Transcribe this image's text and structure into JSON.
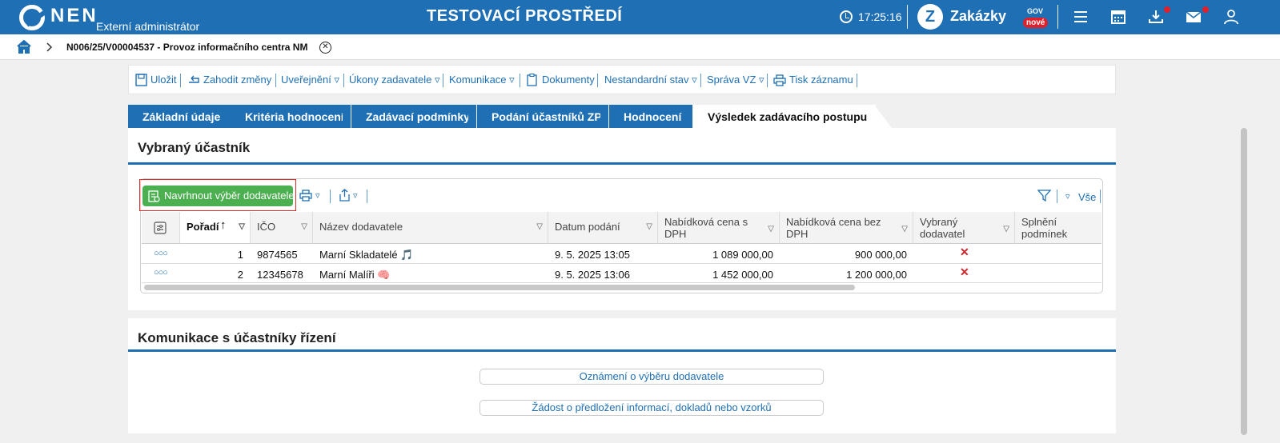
{
  "header": {
    "logo": "NEN",
    "user_role": "Externí administrátor",
    "environment": "TESTOVACÍ PROSTŘEDÍ",
    "time": "17:25:16",
    "product": "Zakázky",
    "product_sup": "GOV",
    "product_badge": "nové",
    "icons": [
      "menu-icon",
      "calendar-icon",
      "download-icon",
      "mail-icon",
      "user-icon"
    ]
  },
  "breadcrumb": {
    "record": "N006/25/V00004537 - Provoz informačního centra NM"
  },
  "toolbar": {
    "save": "Uložit",
    "discard": "Zahodit změny",
    "publish": "Uveřejnění",
    "actions": "Úkony zadavatele",
    "communication": "Komunikace",
    "documents": "Dokumenty",
    "nonstandard": "Nestandardní stav",
    "management": "Správa VZ",
    "print": "Tisk záznamu"
  },
  "tabs": [
    {
      "label": "Základní údaje",
      "active": false
    },
    {
      "label": "Kritéria hodnocení",
      "active": false
    },
    {
      "label": "Zadávací podmínky",
      "active": false
    },
    {
      "label": "Podání účastníků ZP",
      "active": false
    },
    {
      "label": "Hodnocení",
      "active": false
    },
    {
      "label": "Výsledek zadávacího postupu",
      "active": true
    }
  ],
  "selected_participant": {
    "title": "Vybraný účastník",
    "propose_button": "Navrhnout výběr dodavatele",
    "filter_all": "Vše",
    "columns": {
      "order": "Pořadí",
      "ico": "IČO",
      "name": "Název dodavatele",
      "submitted": "Datum podání",
      "price_vat": "Nabídková cena s DPH",
      "price_novat": "Nabídková cena bez DPH",
      "selected": "Vybraný dodavatel",
      "conditions": "Splnění podmínek"
    },
    "rows": [
      {
        "order": "1",
        "ico": "9874565",
        "name": "Marní Skladatelé",
        "submitted": "9. 5. 2025 13:05",
        "price_vat": "1 089 000,00",
        "price_novat": "900 000,00",
        "selected": "✕",
        "emoji": "🎵"
      },
      {
        "order": "2",
        "ico": "12345678",
        "name": "Marní Malíři",
        "submitted": "9. 5. 2025 13:06",
        "price_vat": "1 452 000,00",
        "price_novat": "1 200 000,00",
        "selected": "✕",
        "emoji": "🧠"
      }
    ]
  },
  "communication": {
    "title": "Komunikace s účastníky řízení",
    "buttons": [
      "Oznámení o výběru dodavatele",
      "Žádost o předložení informací, dokladů nebo vzorků"
    ]
  },
  "colors": {
    "primary": "#1f6fb5",
    "success": "#4caf50",
    "danger": "#d0242c"
  }
}
